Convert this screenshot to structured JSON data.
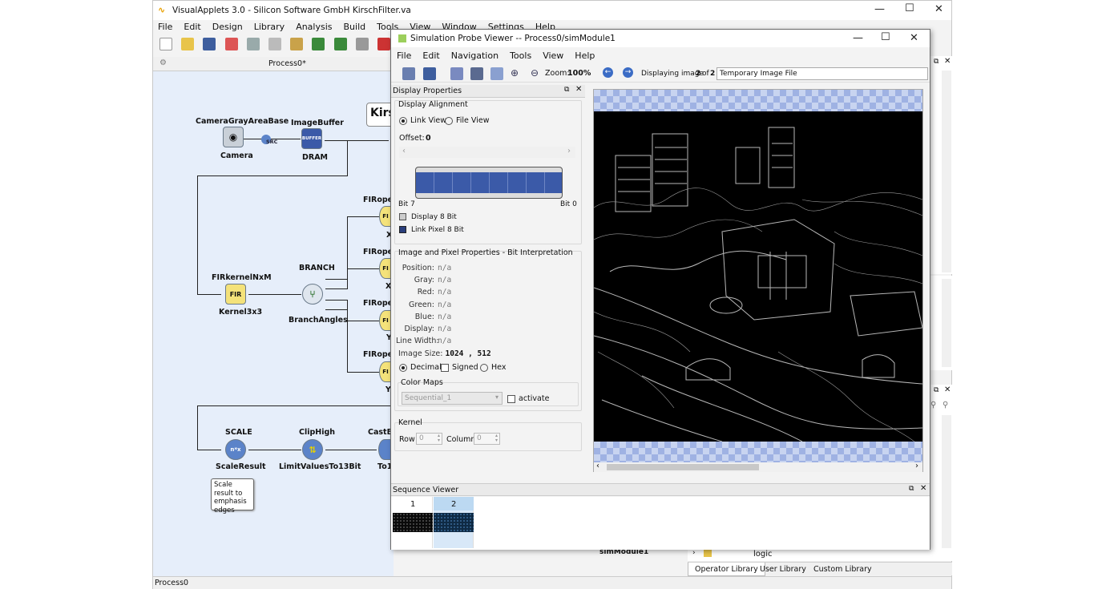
{
  "main_window": {
    "title": "VisualApplets 3.0 - Silicon Software GmbH  KirschFilter.va",
    "menu": [
      "File",
      "Edit",
      "Design",
      "Library",
      "Analysis",
      "Build",
      "Tools",
      "View",
      "Window",
      "Settings",
      "Help"
    ],
    "canvas_tab": "Process0*",
    "status": "Process0"
  },
  "diagram": {
    "nodes": {
      "camera": {
        "title": "CameraGrayAreaBase",
        "caption": "Camera"
      },
      "image_buffer": {
        "title": "ImageBuffer",
        "caption": "DRAM",
        "icon_text": "BUFFER"
      },
      "src_label": "SRC",
      "fir_kernel": {
        "title": "FIRkernelNxM",
        "caption": "Kernel3x3",
        "icon_text": "FIR"
      },
      "branch": {
        "title": "BRANCH",
        "caption": "BranchAngles"
      },
      "fir_ops": [
        {
          "title": "FIRoper",
          "caption": "X"
        },
        {
          "title": "FIRoper",
          "caption": "X"
        },
        {
          "title": "FIRoper",
          "caption": "Y"
        },
        {
          "title": "FIRoper",
          "caption": "Y"
        }
      ],
      "fir_op_icon": "FI",
      "scale": {
        "title": "SCALE",
        "caption": "ScaleResult",
        "icon_text": "n*x"
      },
      "clip": {
        "title": "ClipHigh",
        "caption": "LimitValuesTo13Bit"
      },
      "cast": {
        "title": "CastBi",
        "caption": "To1"
      },
      "kirsch_box": "Kirs",
      "comment": "Scale result to emphasis edges",
      "sim_module_label": "simModule1"
    }
  },
  "right_panel": {
    "tree_item": "logic",
    "tabs": [
      "Operator Library",
      "User Library",
      "Custom Library"
    ]
  },
  "probe_viewer": {
    "title": "Simulation Probe Viewer -- Process0/simModule1",
    "menu": [
      "File",
      "Edit",
      "Navigation",
      "Tools",
      "View",
      "Help"
    ],
    "zoom_label": "Zoom:",
    "zoom_value": "100%",
    "displaying_prefix": "Displaying image",
    "image_index": "2",
    "of_label": "of",
    "image_count": "2",
    "file_field": "Temporary Image File",
    "display_properties": {
      "title": "Display Properties",
      "alignment_label": "Display Alignment",
      "link_view": "Link View",
      "file_view": "File View",
      "offset_label": "Offset:",
      "offset_value": "0",
      "bit_high": "Bit 7",
      "bit_low": "Bit 0",
      "legend_display": "Display 8 Bit",
      "legend_link": "Link Pixel 8 Bit"
    },
    "pixel_properties": {
      "title": "Image and Pixel Properties - Bit Interpretation",
      "rows": [
        {
          "k": "Position:",
          "v": "n/a"
        },
        {
          "k": "Gray:",
          "v": "n/a"
        },
        {
          "k": "Red:",
          "v": "n/a"
        },
        {
          "k": "Green:",
          "v": "n/a"
        },
        {
          "k": "Blue:",
          "v": "n/a"
        },
        {
          "k": "Display:",
          "v": "n/a"
        },
        {
          "k": "Line Width:",
          "v": "n/a"
        }
      ],
      "image_size_label": "Image Size:",
      "image_size_value": "1024 , 512",
      "decimal": "Decimal",
      "signed": "Signed",
      "hex": "Hex",
      "color_maps_label": "Color Maps",
      "color_map_value": "Sequential_1",
      "activate": "activate"
    },
    "kernel": {
      "title": "Kernel",
      "row_label": "Row",
      "row_value": "0",
      "column_label": "Column",
      "column_value": "0"
    },
    "sequence_viewer": {
      "title": "Sequence Viewer",
      "frames": [
        "1",
        "2"
      ]
    }
  },
  "colors": {
    "canvas_bg": "#e6eefa",
    "accent_blue": "#3b5aa8",
    "fir_yellow": "#f4e27a"
  }
}
